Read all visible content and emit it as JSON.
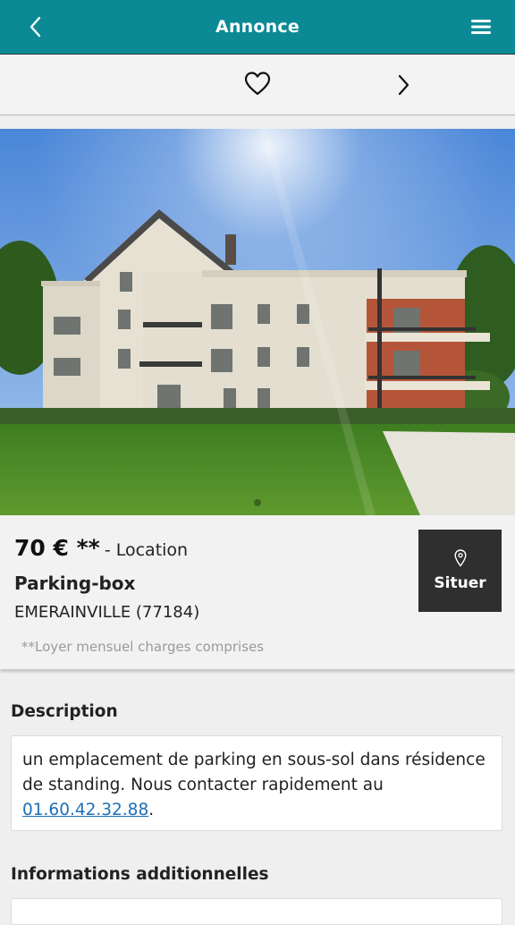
{
  "header": {
    "title": "Annonce",
    "bg_color": "#0b8a96",
    "back_icon": "chevron-left-icon",
    "menu_icon": "hamburger-menu-icon"
  },
  "actionbar": {
    "favorite_icon": "heart-icon",
    "next_icon": "chevron-right-icon"
  },
  "gallery": {
    "image": "photo of apartment building with lawn"
  },
  "listing": {
    "price": "70 € **",
    "price_suffix": "- Location",
    "type": "Parking-box",
    "city": "EMERAINVILLE (77184)",
    "note": "**Loyer mensuel charges comprises",
    "locate_button": "Situer",
    "locate_icon": "map-pin-icon"
  },
  "description": {
    "title": "Description",
    "text": "un emplacement de parking en sous-sol dans résidence de standing. Nous contacter rapidement au",
    "phone": "01.60.42.32.88",
    "text_end": "."
  },
  "additional": {
    "title": "Informations additionnelles"
  }
}
